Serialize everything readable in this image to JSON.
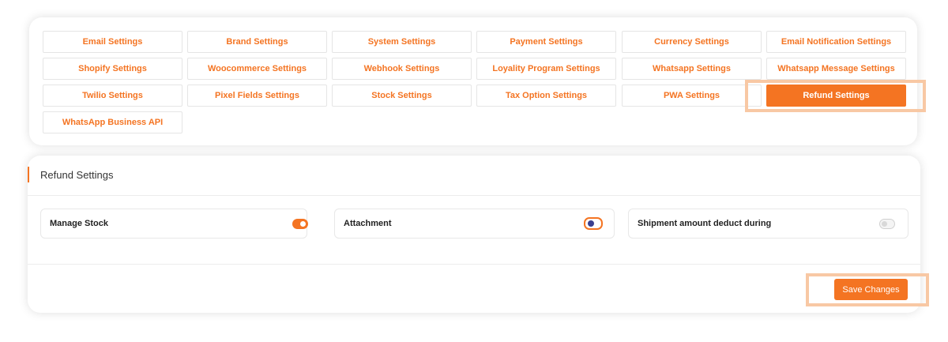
{
  "tabs": [
    "Email Settings",
    "Brand Settings",
    "System Settings",
    "Payment Settings",
    "Currency Settings",
    "Email Notification Settings",
    "Shopify Settings",
    "Woocommerce Settings",
    "Webhook Settings",
    "Loyality Program Settings",
    "Whatsapp Settings",
    "Whatsapp Message Settings",
    "Twilio Settings",
    "Pixel Fields Settings",
    "Stock Settings",
    "Tax Option Settings",
    "PWA Settings",
    "Refund Settings",
    "WhatsApp Business API"
  ],
  "active_tab": "Refund Settings",
  "panel": {
    "title": "Refund Settings",
    "options": [
      {
        "label": "Manage Stock",
        "state": "on"
      },
      {
        "label": "Attachment",
        "state": "focused-off"
      },
      {
        "label": "Shipment amount deduct during",
        "state": "off"
      }
    ],
    "save_label": "Save Changes"
  },
  "colors": {
    "accent": "#f47422",
    "highlight": "#f8c8a4",
    "toggle_knob_focus": "#3a3f8f"
  }
}
